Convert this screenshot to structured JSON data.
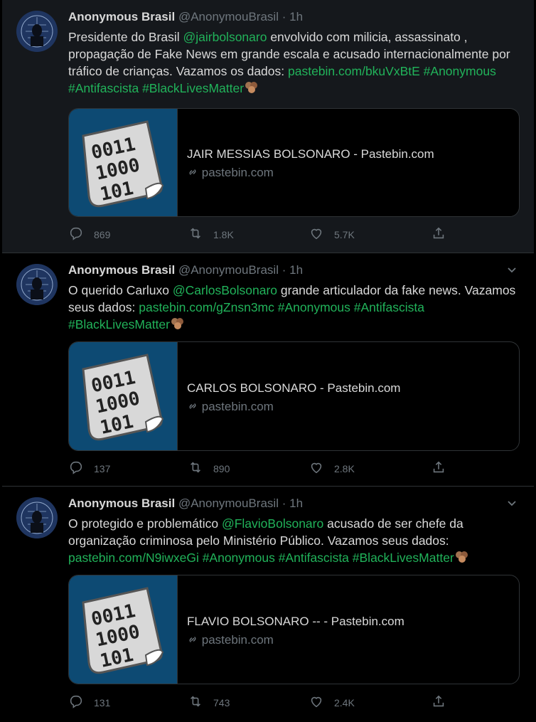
{
  "tweets": [
    {
      "name": "Anonymous Brasil",
      "handle": "@AnonymouBrasil",
      "separator": "·",
      "time": "1h",
      "text_1": "Presidente do Brasil ",
      "mention": "@jairbolsonaro",
      "text_2": " envolvido com milicia, assassinato , propagação de Fake News em grande escala e acusado internacionalmente por tráfico de crianças. Vazamos os dados: ",
      "link": "pastebin.com/bkuVxBtE",
      "hashtags": "#Anonymous #Antifascista #BlackLivesMatter",
      "card_title": "JAIR MESSIAS BOLSONARO - Pastebin.com",
      "card_domain": "pastebin.com",
      "replies": "869",
      "retweets": "1.8K",
      "likes": "5.7K"
    },
    {
      "name": "Anonymous Brasil",
      "handle": "@AnonymouBrasil",
      "separator": "·",
      "time": "1h",
      "text_1": "O querido Carluxo ",
      "mention": "@CarlosBolsonaro",
      "text_2": " grande articulador da fake news. Vazamos seus dados: ",
      "link": "pastebin.com/gZnsn3mc",
      "hashtags": " #Anonymous #Antifascista #BlackLivesMatter",
      "card_title": "CARLOS BOLSONARO - Pastebin.com",
      "card_domain": "pastebin.com",
      "replies": "137",
      "retweets": "890",
      "likes": "2.8K"
    },
    {
      "name": "Anonymous Brasil",
      "handle": "@AnonymouBrasil",
      "separator": "·",
      "time": "1h",
      "text_1": "O protegido e problemático ",
      "mention": "@FlavioBolsonaro",
      "text_2": " acusado de ser chefe da organização criminosa pelo Ministério Público. Vazamos seus dados: ",
      "link": "pastebin.com/N9iwxeGi",
      "hashtags": "  #Anonymous #Antifascista #BlackLivesMatter",
      "card_title": "FLAVIO BOLSONARO -- - Pastebin.com",
      "card_domain": "pastebin.com",
      "replies": "131",
      "retweets": "743",
      "likes": "2.4K"
    }
  ],
  "card_image_text": [
    "0011",
    "1000",
    "101"
  ],
  "icons": {
    "reply": "reply-icon",
    "retweet": "retweet-icon",
    "like": "heart-icon",
    "share": "share-icon",
    "menu": "chevron-down-icon",
    "link": "link-icon",
    "emoji": "raised-fist-emoji"
  },
  "colors": {
    "accent": "#21b35a",
    "muted": "#6e767d",
    "text": "#d9d9d9",
    "background": "#000000",
    "card_image_bg": "#0d4a73"
  }
}
